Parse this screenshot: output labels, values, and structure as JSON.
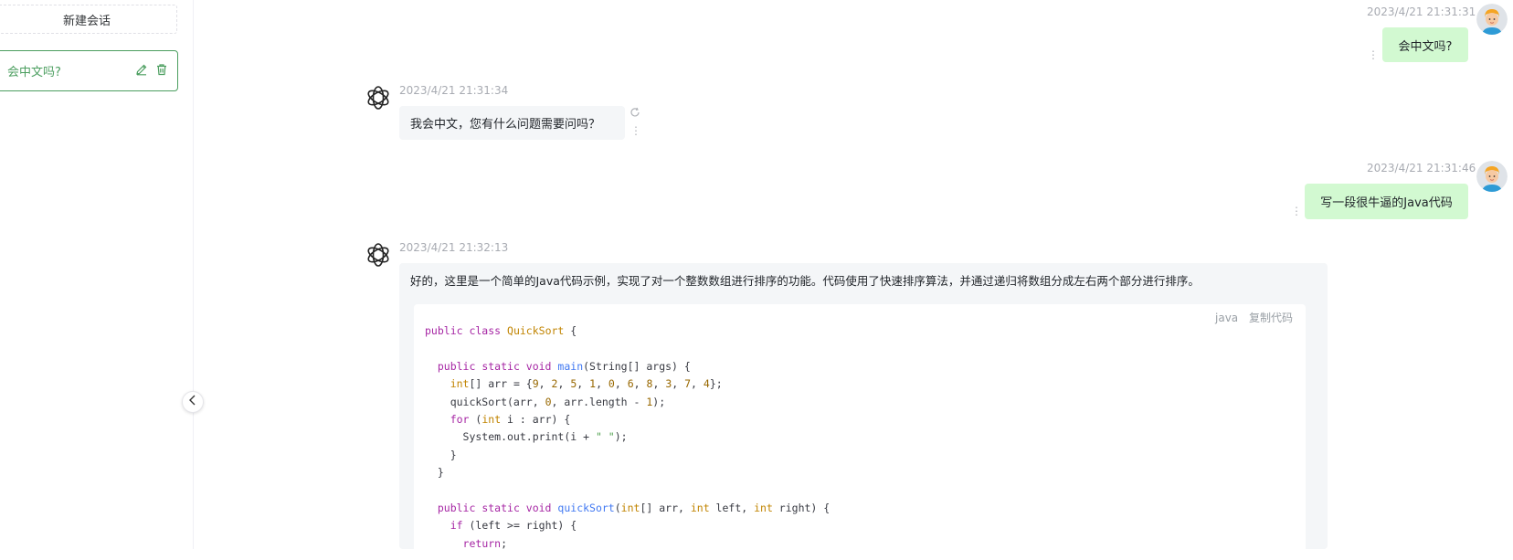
{
  "sidebar": {
    "new_chat_label": "新建会话",
    "conversations": [
      {
        "title": "会中文吗?"
      }
    ]
  },
  "messages": [
    {
      "role": "user",
      "time": "2023/4/21 21:31:31",
      "text": "会中文吗?"
    },
    {
      "role": "assistant",
      "time": "2023/4/21 21:31:34",
      "text": "我会中文，您有什么问题需要问吗？"
    },
    {
      "role": "user",
      "time": "2023/4/21 21:31:46",
      "text": "写一段很牛逼的Java代码"
    },
    {
      "role": "assistant",
      "time": "2023/4/21 21:32:13",
      "text": "好的，这里是一个简单的Java代码示例，实现了对一个整数数组进行排序的功能。代码使用了快速排序算法，并通过递归将数组分成左右两个部分进行排序。",
      "code": {
        "language": "java",
        "copy_label": "复制代码",
        "lines": [
          "public class QuickSort {",
          "",
          "  public static void main(String[] args) {",
          "    int[] arr = {9, 2, 5, 1, 0, 6, 8, 3, 7, 4};",
          "    quickSort(arr, 0, arr.length - 1);",
          "    for (int i : arr) {",
          "      System.out.print(i + \" \");",
          "    }",
          "  }",
          "",
          "  public static void quickSort(int[] arr, int left, int right) {",
          "    if (left >= right) {",
          "      return;"
        ]
      }
    }
  ],
  "icons": {
    "edit": "edit-icon",
    "delete": "trash-icon",
    "collapse": "chevron-left-icon",
    "more": "more-vertical-icon",
    "regenerate": "refresh-icon",
    "assistant_avatar": "openai-logo-icon",
    "user_avatar": "user-avatar-icon"
  },
  "colors": {
    "accent": "#4b9e5f",
    "user_bubble": "#d2f9d1",
    "assistant_bubble": "#f4f6f8"
  }
}
